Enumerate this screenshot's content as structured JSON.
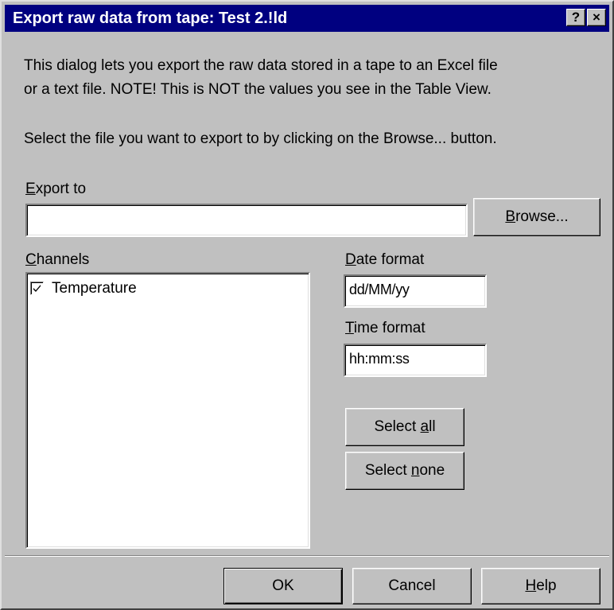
{
  "window": {
    "title": "Export raw data from tape: Test 2.!ld",
    "help_button": "?",
    "close_button": "×"
  },
  "description": {
    "line1": "This dialog lets you export the raw data stored in a tape to an Excel file",
    "line2": "or a text file. NOTE! This is NOT the values you see in the Table View.",
    "line3": "Select the file you want to export to by clicking on the Browse... button."
  },
  "export_to": {
    "label_mnemonic": "E",
    "label_rest": "xport to",
    "value": "",
    "browse_mnemonic": "B",
    "browse_rest": "rowse..."
  },
  "channels": {
    "label_mnemonic": "C",
    "label_rest": "hannels",
    "items": [
      {
        "label": "Temperature",
        "checked": true
      }
    ]
  },
  "date_format": {
    "label_mnemonic": "D",
    "label_rest": "ate format",
    "value": "dd/MM/yy"
  },
  "time_format": {
    "label_mnemonic": "T",
    "label_rest": "ime format",
    "value": "hh:mm:ss"
  },
  "select_all": {
    "prefix": "Select ",
    "mnemonic": "a",
    "rest": "ll"
  },
  "select_none": {
    "prefix": "Select ",
    "mnemonic": "n",
    "rest": "one"
  },
  "footer": {
    "ok": "OK",
    "cancel": "Cancel",
    "help_mnemonic": "H",
    "help_rest": "elp"
  }
}
